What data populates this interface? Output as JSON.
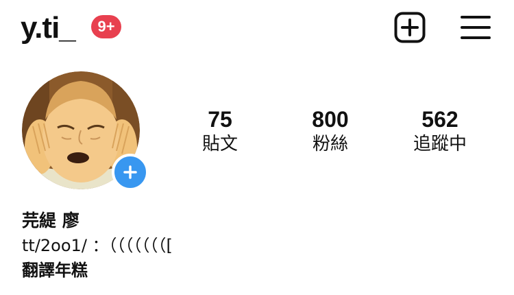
{
  "header": {
    "username": "y.ti_",
    "notification_badge": "9+",
    "badge_color": "#e8404f",
    "new_post_icon": "plus-square-icon",
    "menu_icon": "hamburger-menu-icon"
  },
  "profile": {
    "avatar": "profile-avatar",
    "add_story_icon": "plus-icon",
    "add_story_color": "#3897f0",
    "stats": {
      "posts": {
        "value": "75",
        "label": "貼文"
      },
      "followers": {
        "value": "800",
        "label": "粉絲"
      },
      "following": {
        "value": "562",
        "label": "追蹤中"
      }
    }
  },
  "bio": {
    "display_name": "芫緹 廖",
    "line1": "tt/2oo1/ ：（（（（（（（[",
    "line2": "翻譯年糕"
  }
}
